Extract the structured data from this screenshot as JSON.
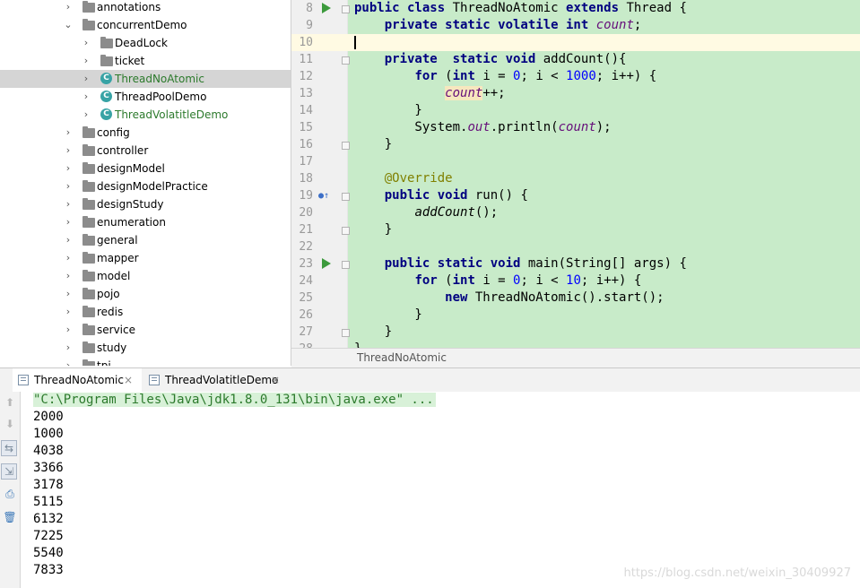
{
  "project_tree": {
    "items": [
      {
        "label": "annotations",
        "kind": "folder",
        "expanded": false,
        "depth": 1
      },
      {
        "label": "concurrentDemo",
        "kind": "folder",
        "expanded": true,
        "depth": 1
      },
      {
        "label": "DeadLock",
        "kind": "folder",
        "expanded": false,
        "depth": 2
      },
      {
        "label": "ticket",
        "kind": "folder",
        "expanded": false,
        "depth": 2
      },
      {
        "label": "ThreadNoAtomic",
        "kind": "class",
        "expanded": false,
        "depth": 2,
        "selected": true,
        "green": true
      },
      {
        "label": "ThreadPoolDemo",
        "kind": "class",
        "expanded": false,
        "depth": 2
      },
      {
        "label": "ThreadVolatitleDemo",
        "kind": "class",
        "expanded": false,
        "depth": 2,
        "green": true
      },
      {
        "label": "config",
        "kind": "folder",
        "expanded": false,
        "depth": 1
      },
      {
        "label": "controller",
        "kind": "folder",
        "expanded": false,
        "depth": 1
      },
      {
        "label": "designModel",
        "kind": "folder",
        "expanded": false,
        "depth": 1
      },
      {
        "label": "designModelPractice",
        "kind": "folder",
        "expanded": false,
        "depth": 1
      },
      {
        "label": "designStudy",
        "kind": "folder",
        "expanded": false,
        "depth": 1
      },
      {
        "label": "enumeration",
        "kind": "folder",
        "expanded": false,
        "depth": 1
      },
      {
        "label": "general",
        "kind": "folder",
        "expanded": false,
        "depth": 1
      },
      {
        "label": "mapper",
        "kind": "folder",
        "expanded": false,
        "depth": 1
      },
      {
        "label": "model",
        "kind": "folder",
        "expanded": false,
        "depth": 1
      },
      {
        "label": "pojo",
        "kind": "folder",
        "expanded": false,
        "depth": 1
      },
      {
        "label": "redis",
        "kind": "folder",
        "expanded": false,
        "depth": 1
      },
      {
        "label": "service",
        "kind": "folder",
        "expanded": false,
        "depth": 1
      },
      {
        "label": "study",
        "kind": "folder",
        "expanded": false,
        "depth": 1
      },
      {
        "label": "tpi",
        "kind": "folder",
        "expanded": false,
        "depth": 1
      }
    ]
  },
  "editor": {
    "breadcrumb": "ThreadNoAtomic",
    "caret_line": 10,
    "lines": [
      {
        "n": "8",
        "gutter": "run",
        "tokens": [
          [
            "kw",
            "public class "
          ],
          [
            "",
            "ThreadNoAtomic "
          ],
          [
            "kw",
            "extends "
          ],
          [
            "",
            "Thread {"
          ]
        ]
      },
      {
        "n": "9",
        "tokens": [
          [
            "",
            "    "
          ],
          [
            "kw",
            "private static volatile int "
          ],
          [
            "fld",
            "count"
          ],
          [
            "",
            ";"
          ]
        ]
      },
      {
        "n": "10",
        "tokens": [
          [
            "",
            ""
          ]
        ]
      },
      {
        "n": "11",
        "gutter": "fold",
        "tokens": [
          [
            "",
            "    "
          ],
          [
            "kw",
            "private  static void "
          ],
          [
            "",
            "addCount(){"
          ]
        ]
      },
      {
        "n": "12",
        "tokens": [
          [
            "",
            "        "
          ],
          [
            "kw",
            "for "
          ],
          [
            "",
            "("
          ],
          [
            "kw",
            "int "
          ],
          [
            "",
            "i = "
          ],
          [
            "num",
            "0"
          ],
          [
            "",
            "; i < "
          ],
          [
            "num",
            "1000"
          ],
          [
            "",
            "; i++) {"
          ]
        ]
      },
      {
        "n": "13",
        "tokens": [
          [
            "",
            "            "
          ],
          [
            "fld hl",
            "count"
          ],
          [
            "",
            "++;"
          ]
        ]
      },
      {
        "n": "14",
        "tokens": [
          [
            "",
            "        }"
          ]
        ]
      },
      {
        "n": "15",
        "tokens": [
          [
            "",
            "        System."
          ],
          [
            "fld",
            "out"
          ],
          [
            "",
            ".println("
          ],
          [
            "fld",
            "count"
          ],
          [
            "",
            ");"
          ]
        ]
      },
      {
        "n": "16",
        "gutter": "fold",
        "tokens": [
          [
            "",
            "    }"
          ]
        ]
      },
      {
        "n": "17",
        "tokens": [
          [
            "",
            ""
          ]
        ]
      },
      {
        "n": "18",
        "tokens": [
          [
            "",
            "    "
          ],
          [
            "ann",
            "@Override"
          ]
        ]
      },
      {
        "n": "19",
        "gutter": "override",
        "tokens": [
          [
            "",
            "    "
          ],
          [
            "kw",
            "public void "
          ],
          [
            "",
            "run() {"
          ]
        ]
      },
      {
        "n": "20",
        "tokens": [
          [
            "",
            "        "
          ],
          [
            "mit",
            "addCount"
          ],
          [
            "",
            "();"
          ]
        ]
      },
      {
        "n": "21",
        "gutter": "fold",
        "tokens": [
          [
            "",
            "    }"
          ]
        ]
      },
      {
        "n": "22",
        "tokens": [
          [
            "",
            ""
          ]
        ]
      },
      {
        "n": "23",
        "gutter": "run",
        "tokens": [
          [
            "",
            "    "
          ],
          [
            "kw",
            "public static void "
          ],
          [
            "",
            "main(String[] args) {"
          ]
        ]
      },
      {
        "n": "24",
        "tokens": [
          [
            "",
            "        "
          ],
          [
            "kw",
            "for "
          ],
          [
            "",
            "("
          ],
          [
            "kw",
            "int "
          ],
          [
            "",
            "i = "
          ],
          [
            "num",
            "0"
          ],
          [
            "",
            "; i < "
          ],
          [
            "num",
            "10"
          ],
          [
            "",
            "; i++) {"
          ]
        ]
      },
      {
        "n": "25",
        "tokens": [
          [
            "",
            "            "
          ],
          [
            "kw",
            "new "
          ],
          [
            "",
            "ThreadNoAtomic().start();"
          ]
        ]
      },
      {
        "n": "26",
        "tokens": [
          [
            "",
            "        }"
          ]
        ]
      },
      {
        "n": "27",
        "gutter": "fold",
        "tokens": [
          [
            "",
            "    }"
          ]
        ]
      },
      {
        "n": "28",
        "tokens": [
          [
            "",
            "}"
          ]
        ]
      }
    ]
  },
  "run_window": {
    "tabs": [
      {
        "label": "ThreadNoAtomic",
        "active": true
      },
      {
        "label": "ThreadVolatitleDemo",
        "active": false
      }
    ],
    "close_glyph": "×",
    "toolbar": [
      {
        "name": "scroll-up-icon",
        "glyph": "⬆"
      },
      {
        "name": "scroll-down-icon",
        "glyph": "⬇"
      },
      {
        "name": "soft-wrap-icon",
        "glyph": "⇆"
      },
      {
        "name": "scroll-to-end-icon",
        "glyph": "⇲"
      },
      {
        "name": "print-icon",
        "glyph": "⎙"
      },
      {
        "name": "clear-all-icon",
        "glyph": "🗑"
      }
    ],
    "command": "\"C:\\Program Files\\Java\\jdk1.8.0_131\\bin\\java.exe\" ...",
    "output": [
      "2000",
      "1000",
      "4038",
      "3366",
      "3178",
      "5115",
      "6132",
      "7225",
      "5540",
      "7833"
    ]
  },
  "watermark": "https://blog.csdn.net/weixin_30409927"
}
